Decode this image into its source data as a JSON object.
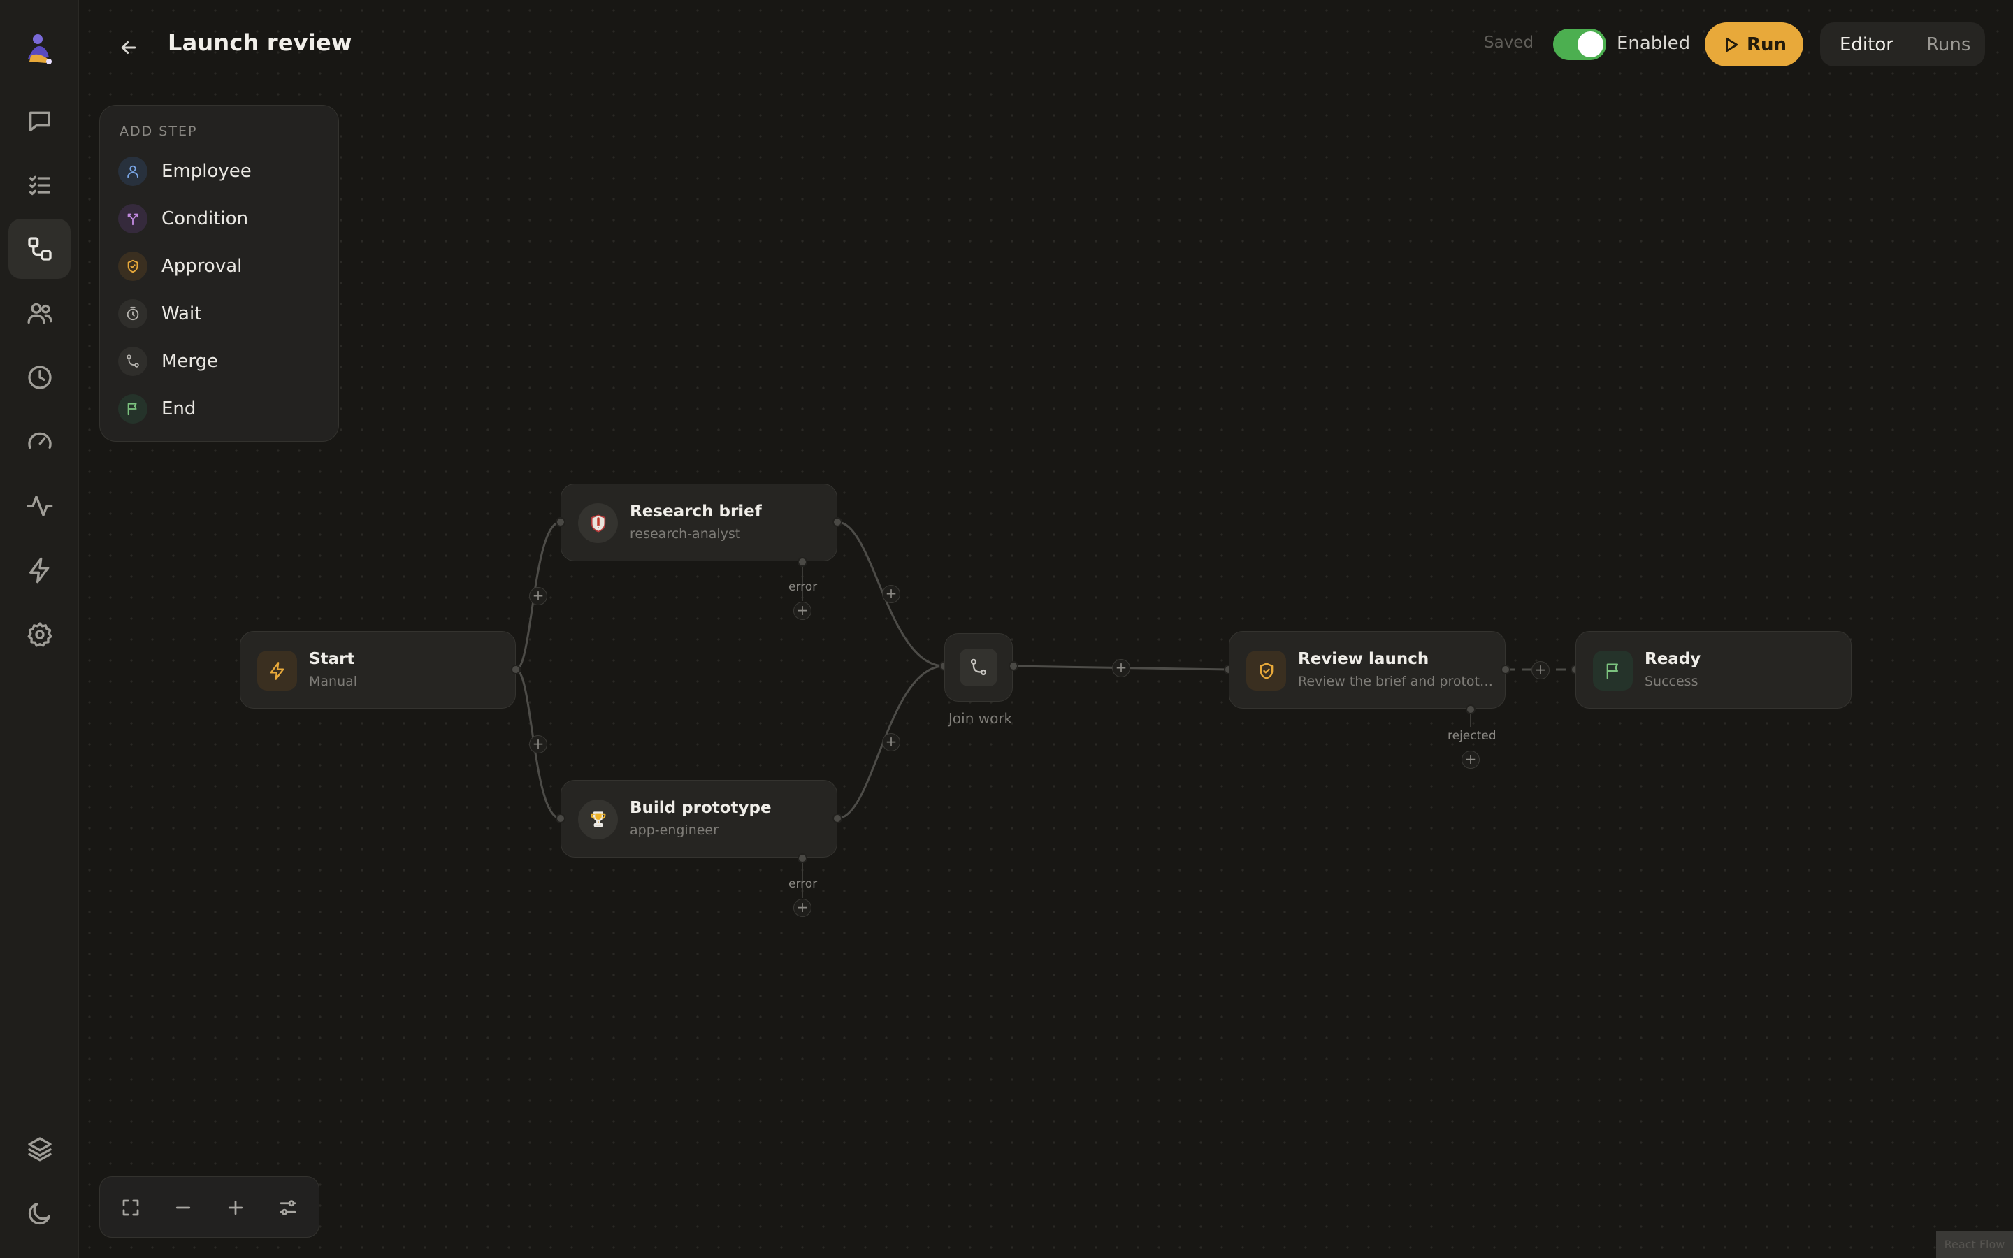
{
  "header": {
    "title": "Launch review",
    "saved_label": "Saved",
    "enabled_label": "Enabled",
    "enabled": true,
    "run_label": "Run",
    "views": [
      "Editor",
      "Runs"
    ],
    "active_view": "Editor"
  },
  "sidebar": {
    "items": [
      {
        "icon": "chat-icon"
      },
      {
        "icon": "tasks-icon"
      },
      {
        "icon": "workflow-icon",
        "active": true
      },
      {
        "icon": "people-icon"
      },
      {
        "icon": "clock-icon"
      },
      {
        "icon": "gauge-icon"
      },
      {
        "icon": "activity-icon"
      },
      {
        "icon": "lightning-icon"
      },
      {
        "icon": "gear-icon"
      }
    ],
    "bottom": [
      {
        "icon": "layers-icon"
      },
      {
        "icon": "moon-icon"
      }
    ]
  },
  "add_step": {
    "title": "ADD STEP",
    "items": [
      {
        "label": "Employee",
        "icon": "person-icon",
        "color": "#7aa7e8"
      },
      {
        "label": "Condition",
        "icon": "branch-icon",
        "color": "#c18ae0"
      },
      {
        "label": "Approval",
        "icon": "shield-icon",
        "color": "#e8a93a"
      },
      {
        "label": "Wait",
        "icon": "timer-icon",
        "color": "#b5b3ae"
      },
      {
        "label": "Merge",
        "icon": "merge-icon",
        "color": "#b5b3ae"
      },
      {
        "label": "End",
        "icon": "flag-icon",
        "color": "#7cc37f"
      }
    ]
  },
  "nodes": {
    "start": {
      "title": "Start",
      "subtitle": "Manual"
    },
    "research": {
      "title": "Research brief",
      "subtitle": "research-analyst"
    },
    "build": {
      "title": "Build prototype",
      "subtitle": "app-engineer"
    },
    "merge": {
      "label": "Join work"
    },
    "review": {
      "title": "Review launch",
      "subtitle": "Review the brief and prototyp..."
    },
    "ready": {
      "title": "Ready",
      "subtitle": "Success"
    }
  },
  "edge_labels": {
    "research_error": "error",
    "build_error": "error",
    "review_rejected": "rejected"
  },
  "colors": {
    "accent": "#e8a93a",
    "toggle_on": "#4caf50",
    "end_green": "#7cc37f"
  },
  "attribution": "React Flow"
}
